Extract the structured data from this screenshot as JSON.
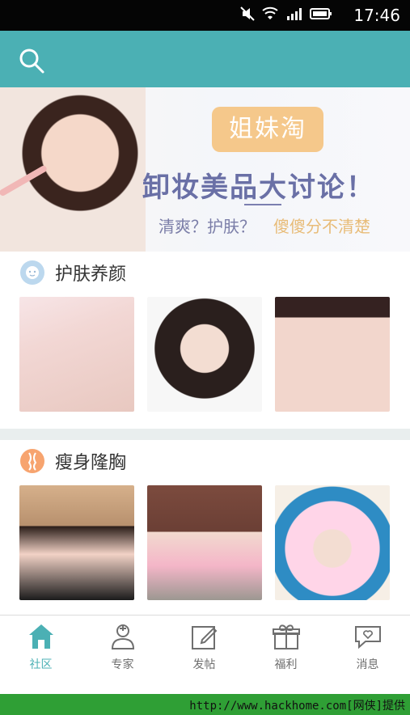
{
  "status_bar": {
    "time": "17:46"
  },
  "header": {
    "search_icon": "search-icon"
  },
  "banner": {
    "badge_text": "姐妹淘",
    "headline": "卸妆美品大讨论！",
    "subtitle_left": "清爽？护肤？",
    "subtitle_right": "傻傻分不清楚",
    "colors": {
      "badge": "#f5c88b",
      "headline": "#6a70a6",
      "accent": "#e8bc78"
    }
  },
  "sections": [
    {
      "title": "护肤养颜",
      "icon": "face-mask-icon",
      "images": [
        "skin-photo-1",
        "skin-photo-2",
        "skin-photo-3"
      ]
    },
    {
      "title": "瘦身隆胸",
      "icon": "body-icon",
      "images": [
        "body-photo-1",
        "body-photo-2",
        "body-photo-3"
      ]
    }
  ],
  "tabs": [
    {
      "label": "社区",
      "icon": "home-icon",
      "active": true
    },
    {
      "label": "专家",
      "icon": "doctor-icon",
      "active": false
    },
    {
      "label": "发帖",
      "icon": "edit-icon",
      "active": false
    },
    {
      "label": "福利",
      "icon": "gift-icon",
      "active": false
    },
    {
      "label": "消息",
      "icon": "message-icon",
      "active": false
    }
  ],
  "footer": {
    "watermark": "http://www.hackhome.com[网侠]提供"
  },
  "theme": {
    "primary": "#4bb0b4",
    "status_bar": "#050505",
    "tab_text": "#6f6f6f"
  }
}
